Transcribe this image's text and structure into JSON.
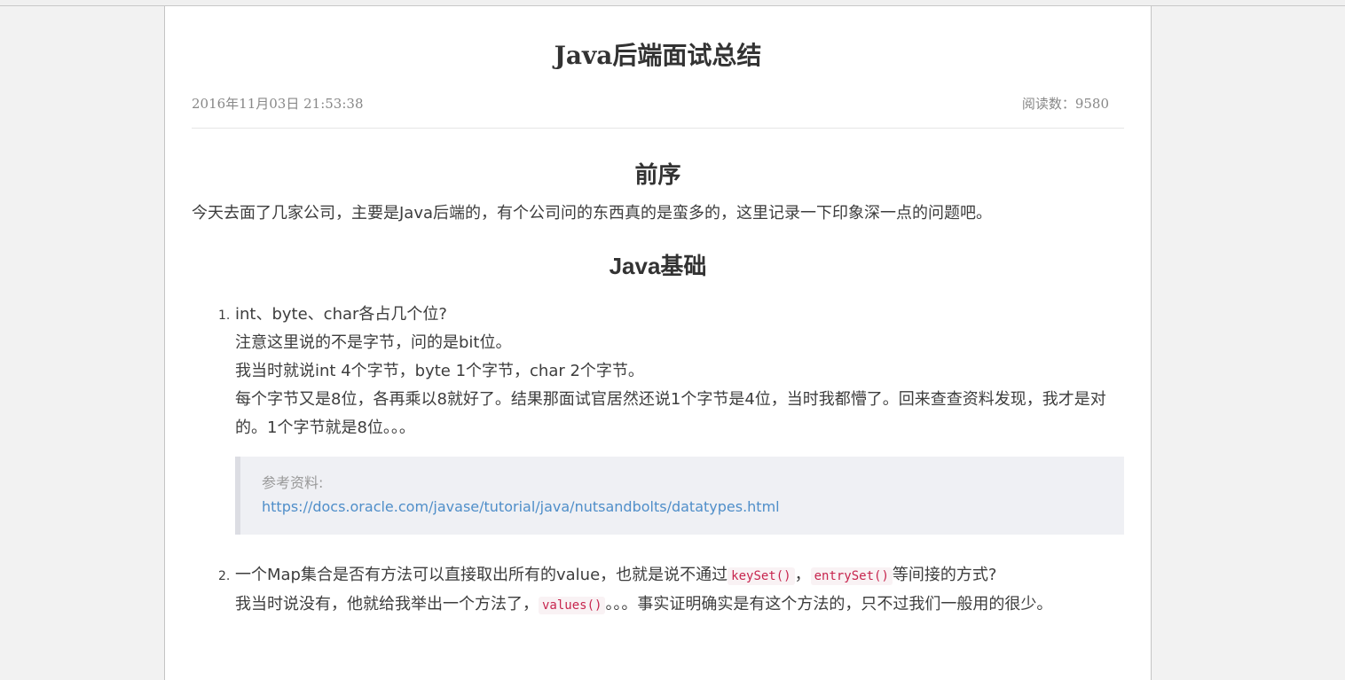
{
  "article": {
    "title": "Java后端面试总结",
    "date": "2016年11月03日 21:53:38",
    "reads": "阅读数：9580"
  },
  "sections": {
    "preface_heading": "前序",
    "preface_text": "今天去面了几家公司，主要是Java后端的，有个公司问的东西真的是蛮多的，这里记录一下印象深一点的问题吧。",
    "java_heading": "Java基础"
  },
  "questions": [
    {
      "number": "1.",
      "question": "int、byte、char各占几个位?",
      "lines": [
        "注意这里说的不是字节，问的是bit位。",
        "我当时就说int 4个字节，byte 1个字节，char 2个字节。",
        "每个字节又是8位，各再乘以8就好了。结果那面试官居然还说1个字节是4位，当时我都懵了。回来查查资料发现，我才是对的。1个字节就是8位。。。"
      ],
      "reference_label": "参考资料:",
      "reference_link": "https://docs.oracle.com/javase/tutorial/java/nutsandbolts/datatypes.html"
    },
    {
      "number": "2.",
      "q_part1": "一个Map集合是否有方法可以直接取出所有的value，也就是说不通过",
      "code1": "keySet()",
      "q_part2": "，",
      "code2": "entrySet()",
      "q_part3": "等间接的方式?",
      "a_part1": "我当时说没有，他就给我举出一个方法了，",
      "code3": "values()",
      "a_part2": "。。。事实证明确实是有这个方法的，只不过我们一般用的很少。"
    }
  ]
}
